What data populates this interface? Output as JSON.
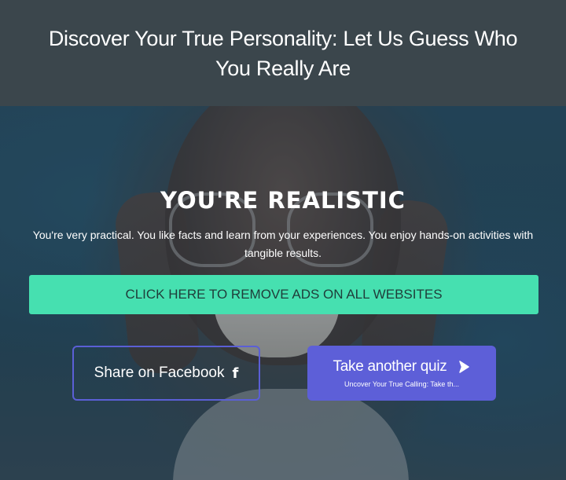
{
  "header": {
    "title": "Discover Your True Personality: Let Us Guess Who You Really Are"
  },
  "result": {
    "title": "YOU'RE REALISTIC",
    "description": "You're very practical. You like facts and learn from your experiences. You enjoy hands-on activities with tangible results."
  },
  "buttons": {
    "remove_ads": "CLICK HERE TO REMOVE ADS ON ALL WEBSITES",
    "share_facebook": "Share on Facebook",
    "share_icon": "f",
    "take_another": "Take another quiz",
    "next_quiz_title": "Uncover Your True Calling: Take th..."
  },
  "icons": {
    "facebook": "facebook-icon",
    "next": "play-arrow-icon"
  },
  "colors": {
    "header_bg": "#3b464c",
    "remove_ads_bg": "#46e0b0",
    "accent": "#5d5fd8"
  }
}
